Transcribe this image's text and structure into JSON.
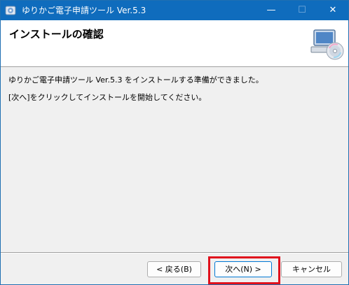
{
  "window": {
    "title": "ゆりかご電子申請ツール Ver.5.3",
    "controls": {
      "minimize": "—",
      "maximize": "☐",
      "close": "✕"
    }
  },
  "header": {
    "title": "インストールの確認"
  },
  "content": {
    "line1": "ゆりかご電子申請ツール Ver.5.3 をインストールする準備ができました。",
    "line2": "[次へ]をクリックしてインストールを開始してください。"
  },
  "buttons": {
    "back": "< 戻る(B)",
    "next": "次へ(N) >",
    "cancel": "キャンセル"
  },
  "colors": {
    "titlebar": "#0f6cbd",
    "highlight": "#e0101c",
    "default_button_border": "#0078d4"
  }
}
